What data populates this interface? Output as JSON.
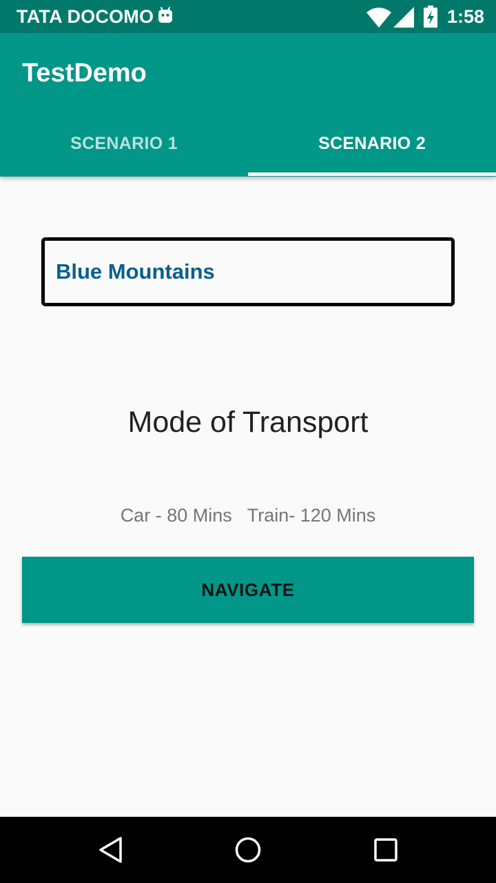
{
  "status_bar": {
    "carrier": "TATA DOCOMO",
    "time": "1:58",
    "icons": [
      "android-icon",
      "wifi-icon",
      "signal-icon",
      "battery-charging-icon"
    ]
  },
  "app_bar": {
    "title": "TestDemo",
    "tabs": [
      {
        "label": "SCENARIO 1",
        "selected": false
      },
      {
        "label": "SCENARIO 2",
        "selected": true
      }
    ]
  },
  "content": {
    "destination": "Blue Mountains",
    "mode_title": "Mode of Transport",
    "times": "Car - 80 Mins   Train- 120 Mins",
    "navigate_label": "NAVIGATE"
  },
  "nav_bar": {
    "icons": [
      "back-icon",
      "home-icon",
      "recents-icon"
    ]
  },
  "colors": {
    "status_bar": "#00796b",
    "primary": "#009688",
    "destination_text": "#075f91",
    "background": "#fafafa"
  }
}
